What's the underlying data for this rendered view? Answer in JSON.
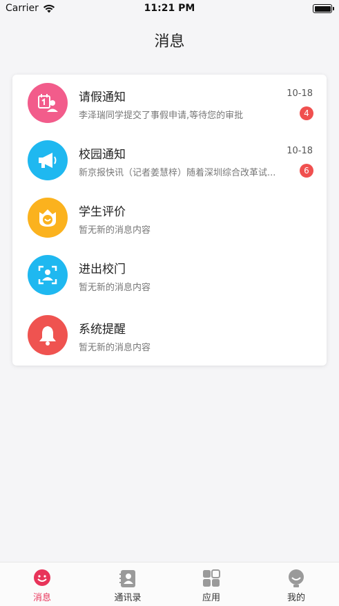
{
  "status_bar": {
    "carrier": "Carrier",
    "time": "11:21 PM"
  },
  "header": {
    "title": "消息"
  },
  "messages": [
    {
      "title": "请假通知",
      "subtitle": "李泽瑞同学提交了事假申请,等待您的审批",
      "date": "10-18",
      "badge": "4",
      "icon": "leave-calendar-icon",
      "color": "#f25c8b"
    },
    {
      "title": "校园通知",
      "subtitle": "新京报快讯（记者姜慧梓）随着深圳综合改革试...",
      "date": "10-18",
      "badge": "6",
      "icon": "megaphone-icon",
      "color": "#1fb8f0"
    },
    {
      "title": "学生评价",
      "subtitle": "暂无新的消息内容",
      "icon": "smiley-badge-icon",
      "color": "#fbb21e"
    },
    {
      "title": "进出校门",
      "subtitle": "暂无新的消息内容",
      "icon": "face-scan-icon",
      "color": "#1fb8f0"
    },
    {
      "title": "系统提醒",
      "subtitle": "暂无新的消息内容",
      "icon": "bell-icon",
      "color": "#ef5350"
    }
  ],
  "tabs": [
    {
      "label": "消息",
      "icon": "message-smile-icon",
      "active": true
    },
    {
      "label": "通讯录",
      "icon": "contacts-book-icon",
      "active": false
    },
    {
      "label": "应用",
      "icon": "apps-grid-icon",
      "active": false
    },
    {
      "label": "我的",
      "icon": "profile-avatar-icon",
      "active": false
    }
  ],
  "colors": {
    "accent": "#e8345a",
    "badge": "#f0504f"
  }
}
